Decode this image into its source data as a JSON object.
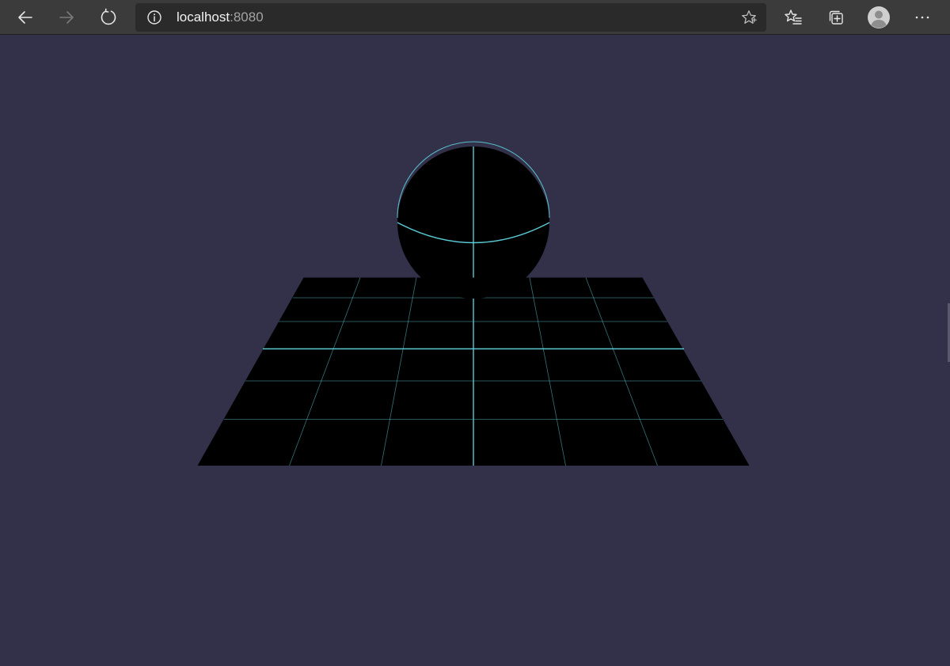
{
  "browser": {
    "url_host": "localhost",
    "url_port": ":8080",
    "icons": {
      "back": "arrow-left-icon",
      "forward": "arrow-right-icon",
      "reload": "reload-icon",
      "info": "info-icon",
      "favorite": "star-icon",
      "favorites": "favorites-icon",
      "collections": "collections-icon",
      "profile": "profile-icon",
      "menu": "more-icon"
    }
  },
  "scene": {
    "background_color": "#323149",
    "mesh_color": "#000000",
    "wireframe_color": "#5fd3dd",
    "objects": [
      "sphere",
      "ground-plane"
    ],
    "ground_grid_divisions": 6
  }
}
